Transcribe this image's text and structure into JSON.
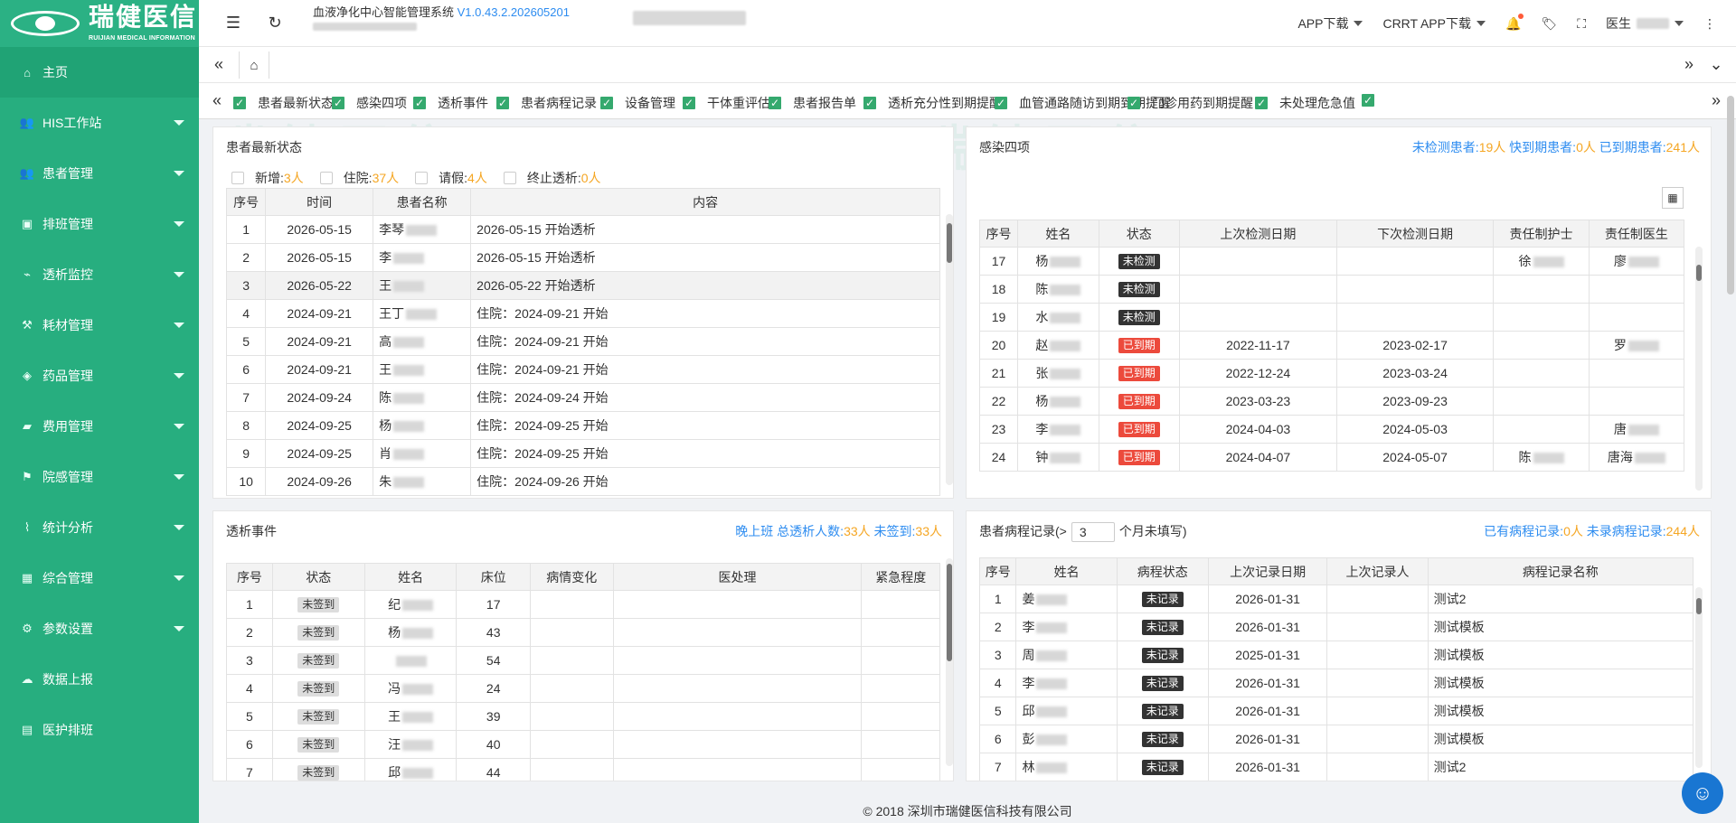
{
  "app": {
    "logo_cn": "瑞健医信",
    "logo_en": "RUIJIAN MEDICAL INFORMATION",
    "system_title": "血液净化中心智能管理系统",
    "version": "V1.0.43.2.202605201"
  },
  "sidebar": {
    "items": [
      {
        "label": "主页",
        "icon": "home-icon"
      },
      {
        "label": "HIS工作站",
        "icon": "users-icon"
      },
      {
        "label": "患者管理",
        "icon": "users-icon"
      },
      {
        "label": "排班管理",
        "icon": "calendar-icon"
      },
      {
        "label": "透析监控",
        "icon": "monitor-icon"
      },
      {
        "label": "耗材管理",
        "icon": "tools-icon"
      },
      {
        "label": "药品管理",
        "icon": "pill-icon"
      },
      {
        "label": "费用管理",
        "icon": "briefcase-icon"
      },
      {
        "label": "院感管理",
        "icon": "flag-icon"
      },
      {
        "label": "统计分析",
        "icon": "chart-icon"
      },
      {
        "label": "综合管理",
        "icon": "grid-icon"
      },
      {
        "label": "参数设置",
        "icon": "gear-icon"
      },
      {
        "label": "数据上报",
        "icon": "upload-icon"
      },
      {
        "label": "医护排班",
        "icon": "list-icon"
      }
    ]
  },
  "header": {
    "app_download": "APP下载",
    "crrt_download": "CRRT APP下载",
    "user": "医生"
  },
  "filters": [
    "患者最新状态",
    "感染四项",
    "透析事件",
    "患者病程记录",
    "设备管理",
    "干体重评估",
    "患者报告单",
    "透析充分性到期提醒",
    "血管通路随访到期到期提醒",
    "门诊用药到期提醒",
    "未处理危急值",
    ""
  ],
  "latest": {
    "title": "患者最新状态",
    "counters": [
      {
        "label": "新增:",
        "value": "3人"
      },
      {
        "label": "住院:",
        "value": "37人"
      },
      {
        "label": "请假:",
        "value": "4人"
      },
      {
        "label": "终止透析:",
        "value": "0人"
      }
    ],
    "headers": [
      "序号",
      "时间",
      "患者名称",
      "内容"
    ],
    "rows": [
      [
        "1",
        "2026-05-15",
        "李琴",
        "2026-05-15 开始透析"
      ],
      [
        "2",
        "2026-05-15",
        "李",
        "2026-05-15 开始透析"
      ],
      [
        "3",
        "2026-05-22",
        "王",
        "2026-05-22 开始透析"
      ],
      [
        "4",
        "2024-09-21",
        "王丁",
        "住院：2024-09-21 开始"
      ],
      [
        "5",
        "2024-09-21",
        "高",
        "住院：2024-09-21 开始"
      ],
      [
        "6",
        "2024-09-21",
        "王",
        "住院：2024-09-21 开始"
      ],
      [
        "7",
        "2024-09-24",
        "陈",
        "住院：2024-09-24 开始"
      ],
      [
        "8",
        "2024-09-25",
        "杨",
        "住院：2024-09-25 开始"
      ],
      [
        "9",
        "2024-09-25",
        "肖",
        "住院：2024-09-25 开始"
      ],
      [
        "10",
        "2024-09-26",
        "朱",
        "住院：2024-09-26 开始"
      ]
    ]
  },
  "infection": {
    "title": "感染四项",
    "stat": {
      "untested_label": "未检测患者:",
      "untested": "19人",
      "soon_label": "快到期患者:",
      "soon": "0人",
      "expired_label": "已到期患者:",
      "expired": "241人"
    },
    "headers": [
      "序号",
      "姓名",
      "状态",
      "上次检测日期",
      "下次检测日期",
      "责任制护士",
      "责任制医生"
    ],
    "rows": [
      [
        "17",
        "杨",
        "未检测",
        "",
        "",
        "徐",
        "廖"
      ],
      [
        "18",
        "陈",
        "未检测",
        "",
        "",
        "",
        ""
      ],
      [
        "19",
        "水",
        "未检测",
        "",
        "",
        "",
        ""
      ],
      [
        "20",
        "赵",
        "已到期",
        "2022-11-17",
        "2023-02-17",
        "",
        "罗"
      ],
      [
        "21",
        "张",
        "已到期",
        "2022-12-24",
        "2023-03-24",
        "",
        ""
      ],
      [
        "22",
        "杨",
        "已到期",
        "2023-03-23",
        "2023-09-23",
        "",
        ""
      ],
      [
        "23",
        "李",
        "已到期",
        "2024-04-03",
        "2024-05-03",
        "",
        "唐"
      ],
      [
        "24",
        "钟",
        "已到期",
        "2024-04-07",
        "2024-05-07",
        "陈",
        "唐海"
      ]
    ]
  },
  "events": {
    "title": "透析事件",
    "stat": {
      "shift": "晚上班",
      "total_label": "总透析人数:",
      "total": "33人",
      "unsigned_label": "未签到:",
      "unsigned": "33人"
    },
    "headers": [
      "序号",
      "状态",
      "姓名",
      "床位",
      "病情变化",
      "医处理",
      "紧急程度"
    ],
    "rows": [
      [
        "1",
        "未签到",
        "纪",
        "17"
      ],
      [
        "2",
        "未签到",
        "杨",
        "43"
      ],
      [
        "3",
        "未签到",
        "",
        "54"
      ],
      [
        "4",
        "未签到",
        "冯",
        "24"
      ],
      [
        "5",
        "未签到",
        "王",
        "39"
      ],
      [
        "6",
        "未签到",
        "汪",
        "40"
      ],
      [
        "7",
        "未签到",
        "邱",
        "44"
      ]
    ]
  },
  "records": {
    "title_prefix": "患者病程记录(>",
    "months": "3",
    "title_suffix": "个月未填写)",
    "stat": {
      "has_label": "已有病程记录:",
      "has": "0人",
      "none_label": "未录病程记录:",
      "none": "244人"
    },
    "headers": [
      "序号",
      "姓名",
      "病程状态",
      "上次记录日期",
      "上次记录人",
      "病程记录名称"
    ],
    "rows": [
      [
        "1",
        "姜",
        "未记录",
        "2026-01-31",
        "",
        "测试2"
      ],
      [
        "2",
        "李",
        "未记录",
        "2026-01-31",
        "",
        "测试模板"
      ],
      [
        "3",
        "周",
        "未记录",
        "2025-01-31",
        "",
        "测试模板"
      ],
      [
        "4",
        "李",
        "未记录",
        "2026-01-31",
        "",
        "测试模板"
      ],
      [
        "5",
        "邱",
        "未记录",
        "2026-01-31",
        "",
        "测试模板"
      ],
      [
        "6",
        "彭",
        "未记录",
        "2026-01-31",
        "",
        "测试模板"
      ],
      [
        "7",
        "林",
        "未记录",
        "2026-01-31",
        "",
        "测试2"
      ]
    ]
  },
  "footer": "© 2018 深圳市瑞健医信科技有限公司"
}
